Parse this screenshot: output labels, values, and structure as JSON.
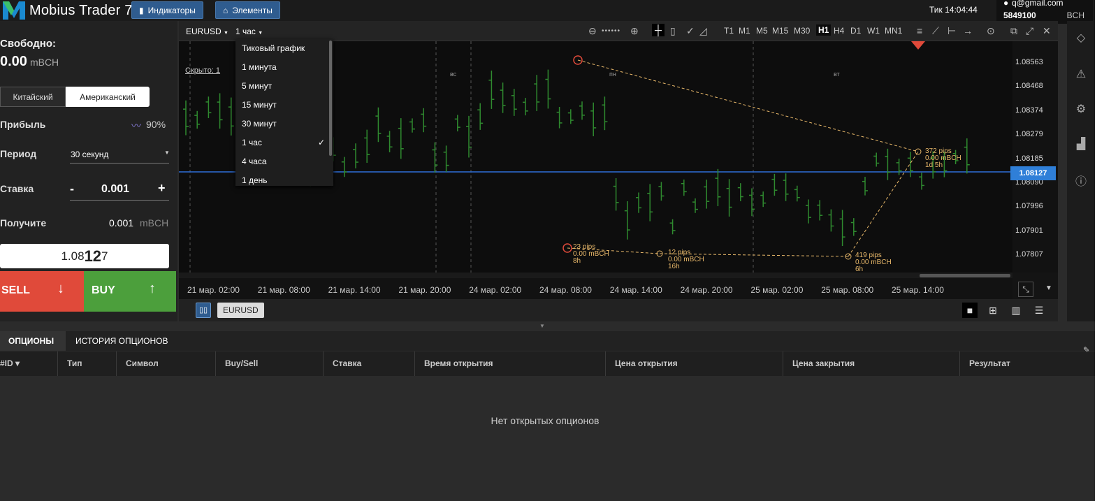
{
  "app": {
    "title": "Mobius Trader 7",
    "indicators_btn": "Индикаторы",
    "elements_btn": "Элементы"
  },
  "status": {
    "tick_label": "Тик",
    "time": "14:04:44"
  },
  "account": {
    "email": "q@gmail.com",
    "number": "5849100",
    "currency": "BCH"
  },
  "trade_panel": {
    "free_label": "Свободно:",
    "free_value": "0.00",
    "free_currency": "mBCH",
    "type_chinese": "Китайский",
    "type_american": "Американский",
    "profit_label": "Прибыль",
    "profit_value": "90%",
    "period_label": "Период",
    "period_value": "30 секунд",
    "stake_label": "Ставка",
    "stake_minus": "-",
    "stake_value": "0.001",
    "stake_plus": "+",
    "receive_label": "Получите",
    "receive_value": "0.001",
    "receive_currency": "mBCH",
    "price_prefix": "1.08",
    "price_big": "12",
    "price_suffix": "7",
    "sell_label": "SELL",
    "sell_arrow": "↓",
    "buy_label": "BUY",
    "buy_arrow": "↑"
  },
  "chart_toolbar": {
    "symbol": "EURUSD",
    "period": "1 час",
    "timeframes": [
      "T1",
      "M1",
      "M5",
      "M15",
      "M30",
      "H1",
      "H4",
      "D1",
      "W1",
      "MN1"
    ],
    "active_timeframe": "H1"
  },
  "period_menu": {
    "items": [
      "Тиковый график",
      "1 минута",
      "5 минут",
      "15 минут",
      "30 минут",
      "1 час",
      "4 часа",
      "1 день"
    ],
    "checked": "1 час",
    "check_mark": "✓"
  },
  "chart": {
    "hidden_label": "Скрыто: 1",
    "day_labels": [
      "вс",
      "пн",
      "вт"
    ],
    "current_price": "1.08127",
    "y_ticks": [
      "1.08563",
      "1.08468",
      "1.08374",
      "1.08279",
      "1.08185",
      "1.08090",
      "1.07996",
      "1.07901",
      "1.07807"
    ],
    "x_ticks": [
      "21 мар. 02:00",
      "21 мар. 08:00",
      "21 мар. 14:00",
      "21 мар. 20:00",
      "24 мар. 02:00",
      "24 мар. 08:00",
      "24 мар. 14:00",
      "24 мар. 20:00",
      "25 мар. 02:00",
      "25 мар. 08:00",
      "25 мар. 14:00"
    ],
    "annotations": [
      {
        "l1": "372 pips",
        "l2": "0.00 mBCH",
        "l3": "1d 5h"
      },
      {
        "l1": "23 pips",
        "l2": "0.00 mBCH",
        "l3": "8h"
      },
      {
        "l1": "12 pips",
        "l2": "0.00 mBCH",
        "l3": "16h"
      },
      {
        "l1": "419 pips",
        "l2": "0.00 mBCH",
        "l3": "6h"
      }
    ]
  },
  "chart_tabs": {
    "symbol_tab": "EURUSD"
  },
  "options_panel": {
    "tab_options": "ОПЦИОНЫ",
    "tab_history": "ИСТОРИЯ ОПЦИОНОВ",
    "columns": [
      "#ID",
      "Тип",
      "Символ",
      "Buy/Sell",
      "Ставка",
      "Время открытия",
      "Цена открытия",
      "Цена закрытия",
      "Результат"
    ],
    "empty_message": "Нет открытых опционов"
  },
  "colors": {
    "accent": "#2f7fd8",
    "sell": "#e04a3a",
    "buy": "#4c9f3c",
    "annotation": "#e8b86a"
  }
}
